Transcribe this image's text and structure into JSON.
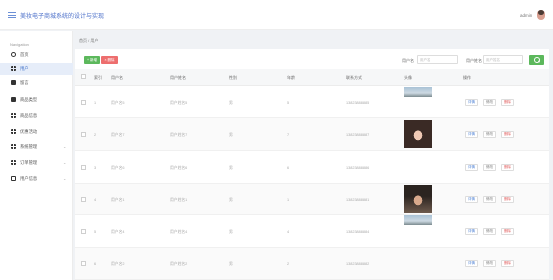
{
  "header": {
    "title": "美妆电子商城系统的设计与实现",
    "user": "admin"
  },
  "sidebar": {
    "heading": "Navigation",
    "items": [
      {
        "label": "首页",
        "icon": "home-icon",
        "active": false
      },
      {
        "label": "用户",
        "icon": "user-grid-icon",
        "active": true
      },
      {
        "label": "留言",
        "icon": "message-icon",
        "active": false
      },
      {
        "label": "商品类型",
        "icon": "category-icon",
        "active": false
      },
      {
        "label": "商品信息",
        "icon": "product-grid-icon",
        "active": false
      },
      {
        "label": "优惠活动",
        "icon": "discount-grid-icon",
        "active": false
      },
      {
        "label": "系统管理",
        "icon": "system-grid-icon",
        "active": false,
        "arrow": "⌄"
      },
      {
        "label": "订单管理",
        "icon": "order-grid-icon",
        "active": false,
        "arrow": "⌄"
      },
      {
        "label": "用户信息",
        "icon": "user-info-icon",
        "active": false,
        "arrow": "⌄"
      }
    ]
  },
  "breadcrumb": {
    "home": "首页",
    "sep": "/",
    "current": "用户"
  },
  "toolbar": {
    "add": "+ 新增",
    "delete": "× 删除"
  },
  "filters": [
    {
      "label": "用户名",
      "placeholder": "用户名"
    },
    {
      "label": "用户姓名",
      "placeholder": "用户姓名"
    }
  ],
  "table": {
    "columns": [
      "索引",
      "用户名",
      "用户姓名",
      "性别",
      "年龄",
      "联系方式",
      "头像",
      "操作"
    ],
    "actions": {
      "view": "详情",
      "edit": "修改",
      "delete": "删除"
    },
    "rows": [
      {
        "index": "1",
        "username": "用户名5",
        "name": "用户姓名5",
        "gender": "男",
        "age": "5",
        "phone": "13823888885",
        "avatar": "landscape"
      },
      {
        "index": "2",
        "username": "用户名7",
        "name": "用户姓名7",
        "gender": "男",
        "age": "7",
        "phone": "13823888887",
        "avatar": "woman"
      },
      {
        "index": "3",
        "username": "用户名6",
        "name": "用户姓名6",
        "gender": "男",
        "age": "6",
        "phone": "13823888886",
        "avatar": "none"
      },
      {
        "index": "4",
        "username": "用户名1",
        "name": "用户姓名1",
        "gender": "男",
        "age": "1",
        "phone": "13823888881",
        "avatar": "man"
      },
      {
        "index": "5",
        "username": "用户名4",
        "name": "用户姓名4",
        "gender": "男",
        "age": "4",
        "phone": "13823888884",
        "avatar": "landscape"
      },
      {
        "index": "6",
        "username": "用户名2",
        "name": "用户姓名2",
        "gender": "男",
        "age": "2",
        "phone": "13823888882",
        "avatar": "none"
      }
    ]
  },
  "colors": {
    "accent": "#4b6fc9",
    "success": "#5cb85c",
    "danger": "#ed6e6e"
  }
}
